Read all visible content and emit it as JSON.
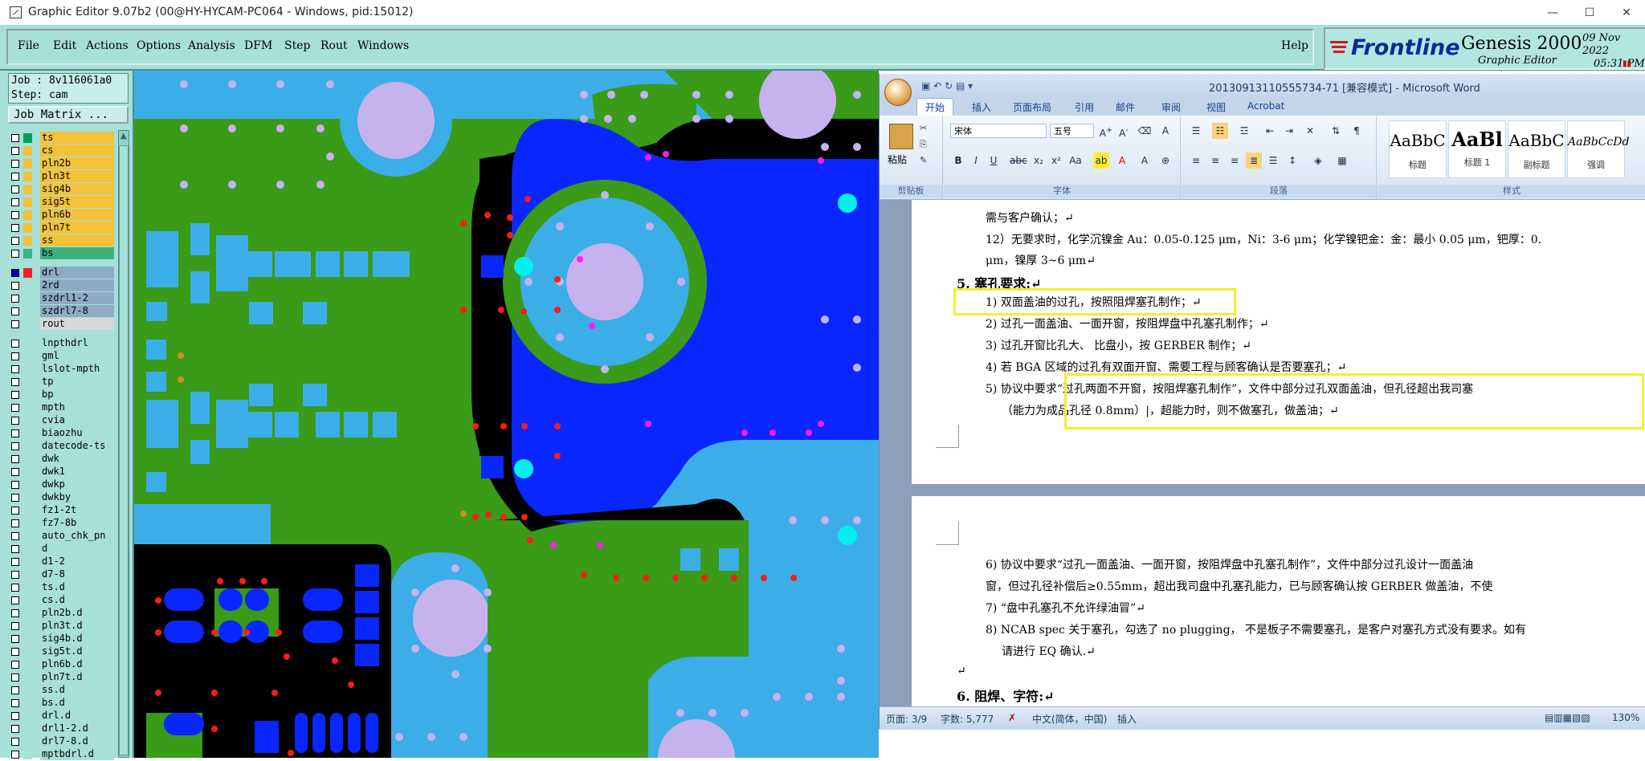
{
  "window": {
    "title": "Graphic Editor 9.07b2 (00@HY-HYCAM-PC064 - Windows, pid:15012)",
    "controls": [
      "—",
      "☐",
      "✕"
    ]
  },
  "menu": {
    "items": [
      "File",
      "Edit",
      "Actions",
      "Options",
      "Analysis",
      "DFM",
      "Step",
      "Rout",
      "Windows"
    ],
    "help": "Help"
  },
  "brand": {
    "logo": "Frontline",
    "product": "Genesis 2000",
    "subtitle": "Graphic Editor",
    "date": "09 Nov 2022",
    "time": "05:31 PM"
  },
  "job": {
    "job_line": "Job : 8v116061a0",
    "step_line": "Step: cam",
    "matrix_button": "Job Matrix ..."
  },
  "layers": [
    {
      "name": "ts",
      "color": "#f2c23a",
      "swatch": "#00a05a",
      "mark": "⬋"
    },
    {
      "name": "cs",
      "color": "#f2c23a",
      "swatch": "#f2c23a",
      "mark": "⬋"
    },
    {
      "name": "pln2b",
      "color": "#f2c23a",
      "swatch": "#f2c23a",
      "mark": "⬋"
    },
    {
      "name": "pln3t",
      "color": "#f2c23a",
      "swatch": "#f2c23a",
      "mark": "⬋"
    },
    {
      "name": "sig4b",
      "color": "#f2c23a",
      "swatch": "#f2c23a",
      "mark": ""
    },
    {
      "name": "sig5t",
      "color": "#f2c23a",
      "swatch": "#f2c23a",
      "mark": ""
    },
    {
      "name": "pln6b",
      "color": "#f2c23a",
      "swatch": "#f2c23a",
      "mark": "⬋"
    },
    {
      "name": "pln7t",
      "color": "#f2c23a",
      "swatch": "#f2c23a",
      "mark": "⬋"
    },
    {
      "name": "ss",
      "color": "#f2c23a",
      "swatch": "#f2c23a",
      "mark": "⬋"
    },
    {
      "name": "bs",
      "color": "#3bb27f",
      "swatch": "#3bb27f",
      "mark": "⬋"
    },
    {
      "sep": true
    },
    {
      "name": "drl",
      "color": "#8eaac4",
      "swatch": "#e23",
      "mark": "≡",
      "on": true
    },
    {
      "name": "2rd",
      "color": "#8eaac4",
      "swatch": "#a7dfd9",
      "mark": ""
    },
    {
      "name": "szdrl1-2",
      "color": "#8eaac4",
      "swatch": "#a7dfd9",
      "mark": ""
    },
    {
      "name": "szdrl7-8",
      "color": "#8eaac4",
      "swatch": "#a7dfd9",
      "mark": ""
    },
    {
      "name": "rout",
      "color": "#d8d8d8",
      "swatch": "#a7dfd9",
      "mark": ""
    },
    {
      "sep": true
    },
    {
      "name": "lnpthdrl",
      "color": "#a7dfd9",
      "swatch": "#a7dfd9",
      "mark": ""
    },
    {
      "name": "gml",
      "color": "#a7dfd9",
      "swatch": "#a7dfd9",
      "mark": "⬋"
    },
    {
      "name": "lslot-mpth",
      "color": "#a7dfd9",
      "swatch": "#a7dfd9",
      "mark": ""
    },
    {
      "name": "tp",
      "color": "#a7dfd9",
      "swatch": "#a7dfd9",
      "mark": ""
    },
    {
      "name": "bp",
      "color": "#a7dfd9",
      "swatch": "#a7dfd9",
      "mark": ""
    },
    {
      "name": "mpth",
      "color": "#a7dfd9",
      "swatch": "#a7dfd9",
      "mark": ""
    },
    {
      "name": "cvia",
      "color": "#a7dfd9",
      "swatch": "#a7dfd9",
      "mark": ""
    },
    {
      "name": "biaozhu",
      "color": "#a7dfd9",
      "swatch": "#a7dfd9",
      "mark": ""
    },
    {
      "name": "datecode-ts",
      "color": "#a7dfd9",
      "swatch": "#a7dfd9",
      "mark": ""
    },
    {
      "name": "dwk",
      "color": "#a7dfd9",
      "swatch": "#a7dfd9",
      "mark": ""
    },
    {
      "name": "dwk1",
      "color": "#a7dfd9",
      "swatch": "#a7dfd9",
      "mark": ""
    },
    {
      "name": "dwkp",
      "color": "#a7dfd9",
      "swatch": "#a7dfd9",
      "mark": ""
    },
    {
      "name": "dwkby",
      "color": "#a7dfd9",
      "swatch": "#a7dfd9",
      "mark": ""
    },
    {
      "name": "fz1-2t",
      "color": "#a7dfd9",
      "swatch": "#a7dfd9",
      "mark": ""
    },
    {
      "name": "fz7-8b",
      "color": "#a7dfd9",
      "swatch": "#a7dfd9",
      "mark": ""
    },
    {
      "name": "auto_chk_pn",
      "color": "#a7dfd9",
      "swatch": "#a7dfd9",
      "mark": ""
    },
    {
      "name": "d",
      "color": "#a7dfd9",
      "swatch": "#a7dfd9",
      "mark": ""
    },
    {
      "name": "d1-2",
      "color": "#a7dfd9",
      "swatch": "#a7dfd9",
      "mark": ""
    },
    {
      "name": "d7-8",
      "color": "#a7dfd9",
      "swatch": "#a7dfd9",
      "mark": ""
    },
    {
      "name": "ts.d",
      "color": "#a7dfd9",
      "swatch": "#a7dfd9",
      "mark": "⬋"
    },
    {
      "name": "cs.d",
      "color": "#a7dfd9",
      "swatch": "#a7dfd9",
      "mark": "⬋"
    },
    {
      "name": "pln2b.d",
      "color": "#a7dfd9",
      "swatch": "#a7dfd9",
      "mark": "⬋"
    },
    {
      "name": "pln3t.d",
      "color": "#a7dfd9",
      "swatch": "#a7dfd9",
      "mark": "⬋"
    },
    {
      "name": "sig4b.d",
      "color": "#a7dfd9",
      "swatch": "#a7dfd9",
      "mark": ""
    },
    {
      "name": "sig5t.d",
      "color": "#a7dfd9",
      "swatch": "#a7dfd9",
      "mark": ""
    },
    {
      "name": "pln6b.d",
      "color": "#a7dfd9",
      "swatch": "#a7dfd9",
      "mark": "⬋"
    },
    {
      "name": "pln7t.d",
      "color": "#a7dfd9",
      "swatch": "#a7dfd9",
      "mark": "⬋"
    },
    {
      "name": "ss.d",
      "color": "#a7dfd9",
      "swatch": "#a7dfd9",
      "mark": "⬋"
    },
    {
      "name": "bs.d",
      "color": "#a7dfd9",
      "swatch": "#a7dfd9",
      "mark": "⬋"
    },
    {
      "name": "drl.d",
      "color": "#a7dfd9",
      "swatch": "#a7dfd9",
      "mark": ""
    },
    {
      "name": "drl1-2.d",
      "color": "#a7dfd9",
      "swatch": "#a7dfd9",
      "mark": ""
    },
    {
      "name": "drl7-8.d",
      "color": "#a7dfd9",
      "swatch": "#a7dfd9",
      "mark": ""
    },
    {
      "name": "mptbdrl.d",
      "color": "#a7dfd9",
      "swatch": "#a7dfd9",
      "mark": ""
    }
  ],
  "word": {
    "doc_title": "20130913110555734-71 [兼容模式] - Microsoft Word",
    "tabs": [
      "开始",
      "插入",
      "页面布局",
      "引用",
      "邮件",
      "审阅",
      "视图",
      "Acrobat"
    ],
    "clipboard": {
      "paste": "粘贴",
      "label": "剪贴板"
    },
    "font": {
      "name": "宋体",
      "size": "五号",
      "label": "字体"
    },
    "paragraph_label": "段落",
    "styles_label": "样式",
    "styles": [
      {
        "sample": "AaBbC",
        "name": "标题"
      },
      {
        "sample": "AaBl",
        "name": "标题 1"
      },
      {
        "sample": "AaBbC",
        "name": "副标题"
      },
      {
        "sample": "AaBbCcDd",
        "name": "强调"
      }
    ],
    "page1_lines": [
      "需与客户确认；↵",
      "12）无要求时，化学沉镍金 Au：0.05-0.125 μm，Ni：3-6 μm；化学镍钯金：金：最小 0.05 μm，钯厚：0.",
      "μm，镍厚 3~6 μm↵",
      "5.   塞孔要求:↵",
      "1)   双面盖油的过孔，按照阻焊塞孔制作；↵",
      "2)   过孔一面盖油、一面开窗，按阻焊盘中孔塞孔制作；↵",
      "3)   过孔开窗比孔大、  比盘小，按 GERBER 制作；↵",
      "4)   若 BGA 区域的过孔有双面开窗、需要工程与顾客确认是否要塞孔；↵",
      "5)   协议中要求“过孔两面不开窗，按阻焊塞孔制作”，文件中部分过孔双面盖油，但孔径超出我司塞",
      "（能力为成品孔径 0.8mm）|，超能力时，则不做塞孔，做盖油；↵"
    ],
    "page2_lines": [
      "6)   协议中要求“过孔一面盖油、一面开窗，按阻焊盘中孔塞孔制作”，文件中部分过孔设计一面盖油",
      "窗，但过孔径补偿后≥0.55mm，超出我司盘中孔塞孔能力，已与顾客确认按 GERBER 做盖油，不使",
      "7)   “盘中孔塞孔不允许绿油冒”↵",
      "8)   NCAB spec 关于塞孔，勾选了 no plugging， 不是板子不需要塞孔，是客户对塞孔方式没有要求。如有",
      "请进行 EQ 确认.↵",
      "↵",
      "6.   阻焊、字符:↵"
    ],
    "status": {
      "page": "页面: 3/9",
      "words": "字数: 5,777",
      "lang": "中文(简体，中国)",
      "mode": "插入",
      "zoom": "130%"
    }
  }
}
